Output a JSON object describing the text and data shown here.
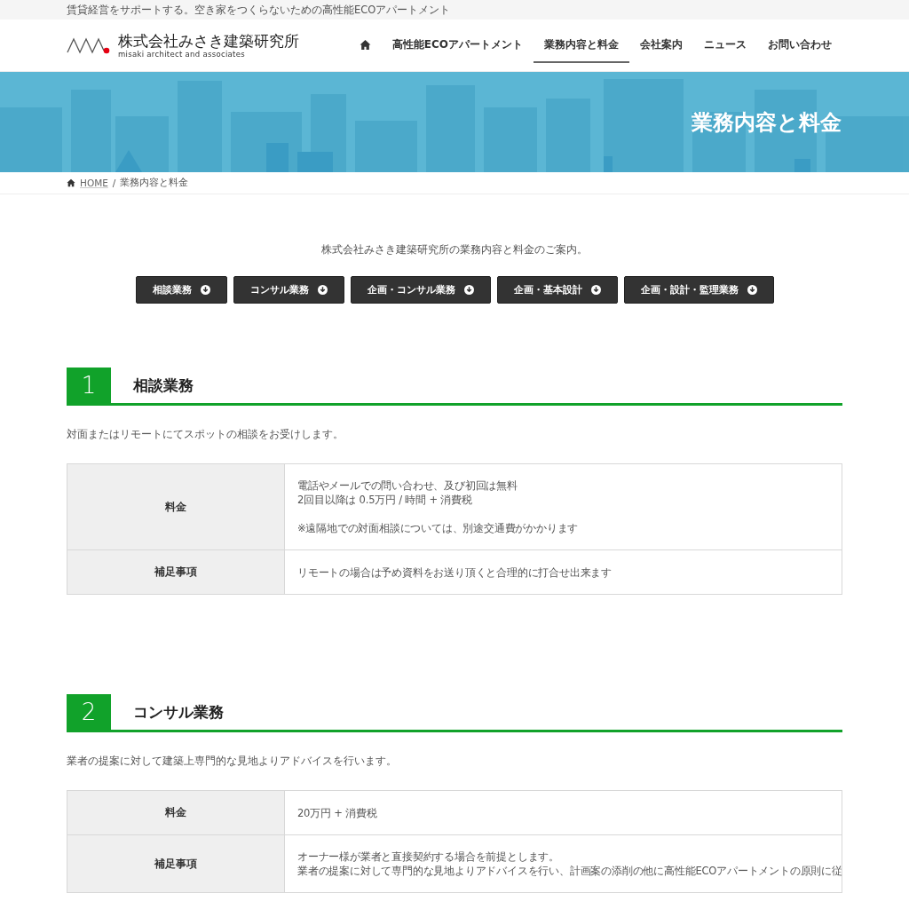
{
  "topbar": {
    "tagline": "賃貸経営をサポートする。空き家をつくらないための高性能ECOアパートメント"
  },
  "header": {
    "logo_title": "株式会社みさき建築研究所",
    "logo_subtitle": "misaki architect and associates",
    "nav": [
      {
        "kind": "home",
        "selected": false
      },
      {
        "kind": "text",
        "label": "高性能ECOアパートメント",
        "selected": false
      },
      {
        "kind": "text",
        "label": "業務内容と料金",
        "selected": true
      },
      {
        "kind": "text",
        "label": "会社案内",
        "selected": false
      },
      {
        "kind": "text",
        "label": "ニュース",
        "selected": false
      },
      {
        "kind": "text",
        "label": "お問い合わせ",
        "selected": false
      }
    ]
  },
  "hero": {
    "title": "業務内容と料金"
  },
  "breadcrumb": {
    "home": "HOME",
    "separator": "/",
    "current": "業務内容と料金"
  },
  "intro": "株式会社みさき建築研究所の業務内容と料金のご案内。",
  "jump_buttons": [
    "相談業務",
    "コンサル業務",
    "企画・コンサル業務",
    "企画・基本設計",
    "企画・設計・監理業務"
  ],
  "sections": [
    {
      "number": "1",
      "title": "相談業務",
      "lead": "対面またはリモートにてスポットの相談をお受けします。",
      "rows": [
        {
          "label": "料金",
          "paragraphs": [
            [
              "電話やメールでの問い合わせ、及び初回は無料",
              "2回目以降は 0.5万円 / 時間 + 消費税"
            ],
            [
              "※遠隔地での対面相談については、別途交通費がかかります"
            ]
          ]
        },
        {
          "label": "補足事項",
          "paragraphs": [
            [
              "リモートの場合は予め資料をお送り頂くと合理的に打合せ出来ます"
            ]
          ]
        }
      ]
    },
    {
      "number": "2",
      "title": "コンサル業務",
      "lead": "業者の提案に対して建築上専門的な見地よりアドバイスを行います。",
      "rows": [
        {
          "label": "料金",
          "paragraphs": [
            [
              "20万円 + 消費税"
            ]
          ]
        },
        {
          "label": "補足事項",
          "paragraphs": [
            [
              "オーナー様が業者と直接契約する場合を前提とします。",
              "業者の提案に対して専門的な見地よりアドバイスを行い、計画案の添削の他に高性能ECOアパートメントの原則に従"
            ]
          ]
        }
      ]
    }
  ]
}
